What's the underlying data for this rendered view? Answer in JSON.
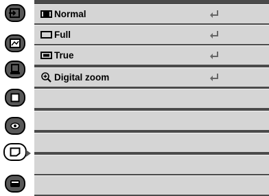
{
  "sidebar": {
    "tabs": [
      {
        "icon": "input-icon"
      },
      {
        "icon": "picture-adjust-icon"
      },
      {
        "icon": "image-select-icon"
      },
      {
        "icon": "screen-icon"
      },
      {
        "icon": "setting-icon"
      },
      {
        "icon": "screen-size-icon",
        "active": true
      },
      {
        "icon": "info-icon"
      }
    ]
  },
  "menu": {
    "items": [
      {
        "label": "Normal",
        "icon": "normal-screen-icon"
      },
      {
        "label": "Full",
        "icon": "full-screen-icon"
      },
      {
        "label": "True",
        "icon": "true-screen-icon"
      },
      {
        "label": "Digital zoom",
        "icon": "zoom-icon"
      }
    ],
    "empty_rows": 6
  },
  "colors": {
    "panel_bg": "#4a4a4a",
    "row_bg": "#d5d5d5",
    "tab_bg": "#585858",
    "enter_icon": "#666666"
  }
}
